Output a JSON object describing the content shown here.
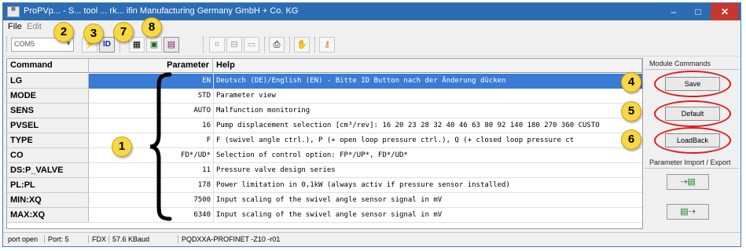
{
  "window": {
    "title": "ProPVp... - S... tool ... rk... ifin Manufacturing Germany GmbH + Co. KG",
    "controls": {
      "minimize": "–",
      "maximize": "□",
      "close": "✕"
    }
  },
  "menu": {
    "file": "File",
    "edit": "Edit"
  },
  "toolbar": {
    "com_port": "COM5",
    "buttons": [
      {
        "name": "connect-icon",
        "glyph": "⚡"
      },
      {
        "name": "id-icon",
        "glyph": "ID"
      },
      {
        "name": "grid-icon",
        "glyph": "▦"
      },
      {
        "name": "monitor-icon",
        "glyph": "▣"
      },
      {
        "name": "chart-icon",
        "glyph": "▤"
      },
      {
        "name": "compare-icon",
        "glyph": "⌗"
      },
      {
        "name": "open-icon",
        "glyph": "⊟"
      },
      {
        "name": "save-icon",
        "glyph": "▭"
      },
      {
        "name": "print-icon",
        "glyph": "⎙"
      },
      {
        "name": "hand-icon",
        "glyph": "✋"
      },
      {
        "name": "key-icon",
        "glyph": "⚷"
      }
    ]
  },
  "callouts": {
    "c1": "1",
    "c2": "2",
    "c3": "3",
    "c4": "4",
    "c5": "5",
    "c6": "6",
    "c7": "7",
    "c8": "8"
  },
  "table": {
    "headers": {
      "command": "Command",
      "parameter": "Parameter",
      "help": "Help"
    },
    "rows": [
      {
        "command": "LG",
        "parameter": "EN",
        "help": "Deutsch (DE)/English (EN) - Bitte ID Button nach der Änderung dücken"
      },
      {
        "command": "MODE",
        "parameter": "STD",
        "help": "Parameter view"
      },
      {
        "command": "SENS",
        "parameter": "AUTO",
        "help": "Malfunction monitoring"
      },
      {
        "command": "PVSEL",
        "parameter": "16",
        "help": "Pump displacement selection [cm³/rev]: 16 20 23 28 32 40 46 63 80 92 140 180 270 360 CUSTO"
      },
      {
        "command": "TYPE",
        "parameter": "F",
        "help": "F (swivel angle ctrl.), P (+ open loop pressure ctrl.), Q (+ closed loop pressure ct"
      },
      {
        "command": "CO",
        "parameter": "FD*/UD*",
        "help": "Selection of control option: FP*/UP*, FD*/UD*"
      },
      {
        "command": "DS:P_VALVE",
        "parameter": "11",
        "help": "Pressure valve design series"
      },
      {
        "command": "PL:PL",
        "parameter": "178",
        "help": "Power limitation in 0,1kW (always activ if pressure sensor installed)"
      },
      {
        "command": "MIN:XQ",
        "parameter": "7500",
        "help": "Input scaling of the swivel angle sensor signal in mV"
      },
      {
        "command": "MAX:XQ",
        "parameter": "6340",
        "help": "Input scaling of the swivel angle sensor signal in mV"
      }
    ]
  },
  "side_panel": {
    "module_commands_label": "Module Commands",
    "save_label": "Save",
    "default_label": "Default",
    "loadback_label": "LoadBack",
    "import_export_label": "Parameter Import / Export",
    "import_glyph": "⇢▤",
    "export_glyph": "▤⇢"
  },
  "status": {
    "port_state": "port open",
    "port": "Port: 5",
    "duplex": "FDX",
    "baud": "57.6 KBaud",
    "module": "PQDXXA-PROFINET -Z10 -r01"
  }
}
